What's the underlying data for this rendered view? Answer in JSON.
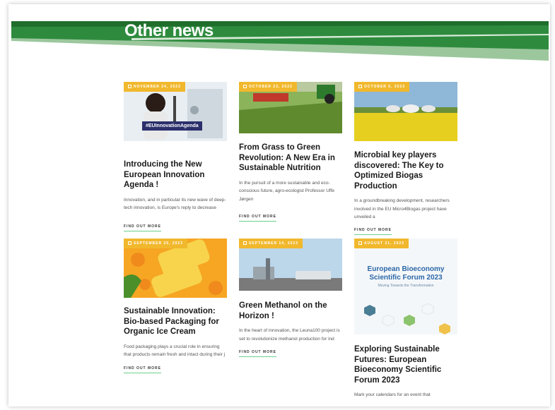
{
  "section": {
    "title": "Other news"
  },
  "colors": {
    "banner_dark": "#2e8b3e",
    "banner_light": "#9cc79d",
    "badge": "#f1b82d",
    "link_underline": "#6ccf8e"
  },
  "cards": [
    {
      "date": "NOVEMBER 24, 2023",
      "title": "Introducing the New European Innovation Agenda !",
      "excerpt": "Innovation, and in particular its new wave of deep-tech innovation, is Europe's reply to decrease",
      "link": "FIND OUT MORE",
      "image_text": "#EUInnovationAgenda"
    },
    {
      "date": "OCTOBER 23, 2023",
      "title": "From Grass to Green Revolution: A New Era in Sustainable Nutrition",
      "excerpt": "In the pursuit of a more sustainable and eco-conscious future, agro-ecologist Professor Uffe Jørgen",
      "link": "FIND OUT MORE"
    },
    {
      "date": "OCTOBER 5, 2023",
      "title": "Microbial key players discovered: The Key to Optimized Biogas Production",
      "excerpt": "In a groundbreaking development, researchers involved in the EU Micro4Biogas project have unveiled a",
      "link": "FIND OUT MORE"
    },
    {
      "date": "SEPTEMBER 25, 2023",
      "title": "Sustainable Innovation: Bio-based Packaging for Organic Ice Cream",
      "excerpt": "Food packaging plays a crucial role in ensuring that products remain fresh and intact during their j",
      "link": "FIND OUT MORE"
    },
    {
      "date": "SEPTEMBER 14, 2023",
      "title": "Green Methanol on the Horizon !",
      "excerpt": "In the heart of innovation, the Leuna100 project is set to revolutionize methanol production for ind",
      "link": "FIND OUT MORE"
    },
    {
      "date": "AUGUST 21, 2023",
      "title": "Exploring Sustainable Futures: European Bioeconomy Scientific Forum 2023",
      "excerpt": "Mark your calendars for an event that",
      "link": "",
      "image_title": "European Bioeconomy Scientific Forum 2023",
      "image_subtitle": "Moving Towards the Transformation"
    }
  ]
}
